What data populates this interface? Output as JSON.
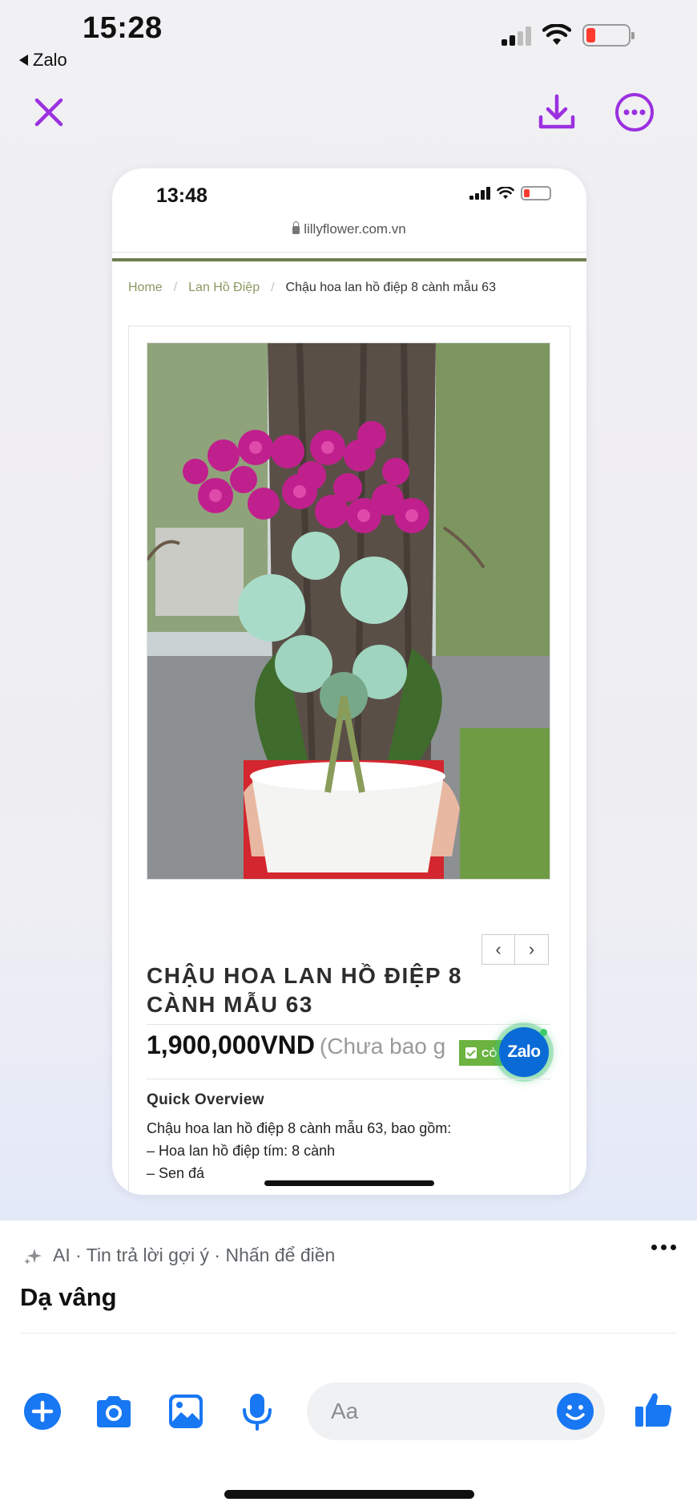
{
  "status_bar": {
    "time": "15:28",
    "back_app": "Zalo"
  },
  "viewer": {
    "actions": [
      "close-icon",
      "download-icon",
      "more-icon"
    ],
    "accent_color": "#9b30e0"
  },
  "screenshot": {
    "status_time": "13:48",
    "url": "lillyflower.com.vn",
    "breadcrumb": {
      "home": "Home",
      "category": "Lan Hồ Điệp",
      "current": "Chậu hoa lan hồ điệp 8 cành mẫu 63"
    },
    "product": {
      "title": "CHẬU HOA LAN HỒ ĐIỆP 8 CÀNH MẪU 63",
      "price": "1,900,000VND",
      "price_note": "(Chưa bao g",
      "stock_badge": "CÒ",
      "zalo_button": "Zalo",
      "quick_overview_title": "Quick Overview",
      "description": [
        "Chậu hoa lan hồ điệp 8 cành mẫu 63, bao gồm:",
        "– Hoa lan hồ điệp tím: 8 cành",
        "– Sen đá"
      ],
      "nav_prev": "‹",
      "nav_next": "›"
    }
  },
  "suggestions": {
    "header": "AI · Tin trả lời gợi ý · Nhấn để điền",
    "reply": "Dạ vâng"
  },
  "composer": {
    "placeholder": "Aa",
    "icons": [
      "plus-icon",
      "camera-icon",
      "image-icon",
      "microphone-icon",
      "emoji-icon",
      "thumbs-up-icon"
    ],
    "accent_color": "#1877f2"
  }
}
